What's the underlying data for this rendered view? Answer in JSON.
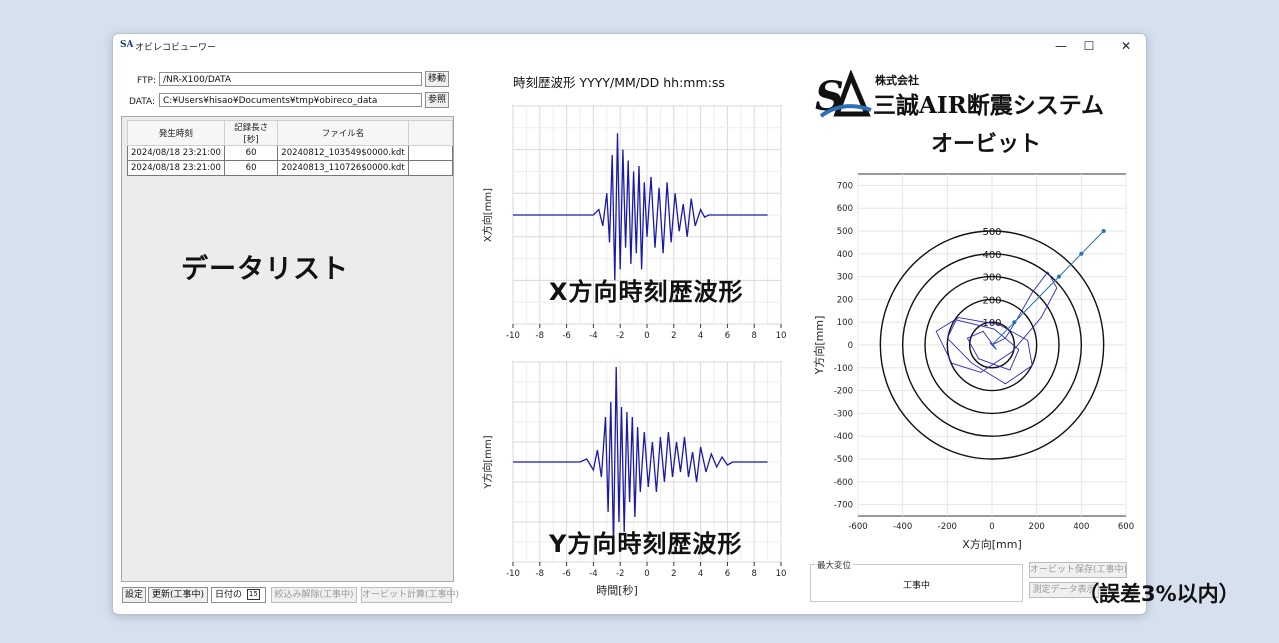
{
  "window": {
    "title": "オビレコビューワー",
    "icon": "SA"
  },
  "ftp": {
    "label": "FTP:",
    "value": "/NR-X100/DATA",
    "button": "移動"
  },
  "data_dir": {
    "label": "DATA:",
    "value": "C:¥Users¥hisao¥Documents¥tmp¥obireco_data",
    "button": "参照"
  },
  "table": {
    "headers": [
      "発生時刻",
      "記録長さ[秒]",
      "ファイル名"
    ],
    "rows": [
      [
        "2024/08/18 23:21:00",
        "60",
        "20240812_103549$0000.kdt"
      ],
      [
        "2024/08/18 23:21:00",
        "60",
        "20240813_110726$0000.kdt"
      ]
    ]
  },
  "list_label": "データリスト",
  "bottom_buttons": {
    "settings": "設定",
    "refresh": "更新(工事中)",
    "date_label": "日付の",
    "calendar": "15",
    "clear_filter": "絞込み解除(工事中)",
    "orbit_calc": "オービット計算(工事中)"
  },
  "waveform": {
    "title": "時刻歴波形 YYYY/MM/DD hh:mm:ss"
  },
  "chart_data": [
    {
      "type": "line",
      "name": "x-wave",
      "ylabel": "X方向[mm]",
      "xlabel": "",
      "overlay": "X方向時刻歴波形",
      "xlim": [
        -10,
        10
      ],
      "xticks": [
        -10,
        -8,
        -6,
        -4,
        -2,
        0,
        2,
        4,
        6,
        8,
        10
      ],
      "x": [
        -10,
        -4.0,
        -3.6,
        -3.3,
        -3.0,
        -2.8,
        -2.6,
        -2.4,
        -2.2,
        -2.0,
        -1.8,
        -1.6,
        -1.4,
        -1.2,
        -1.0,
        -0.8,
        -0.6,
        -0.4,
        -0.2,
        0.0,
        0.3,
        0.6,
        0.9,
        1.2,
        1.5,
        1.8,
        2.1,
        2.4,
        2.7,
        3.0,
        3.3,
        3.6,
        4.0,
        4.3,
        4.6,
        9.0
      ],
      "y": [
        0,
        0,
        0.05,
        -0.1,
        0.2,
        -0.25,
        0.55,
        -0.6,
        0.75,
        -0.5,
        0.6,
        -0.3,
        0.5,
        -0.45,
        0.4,
        -0.35,
        0.45,
        -0.5,
        0.3,
        -0.2,
        0.35,
        -0.3,
        0.25,
        -0.35,
        0.3,
        -0.25,
        0.2,
        -0.15,
        0.1,
        -0.2,
        0.15,
        -0.1,
        0.05,
        -0.02,
        0,
        0
      ],
      "ylim": [
        -1,
        1
      ]
    },
    {
      "type": "line",
      "name": "y-wave",
      "ylabel": "Y方向[mm]",
      "xlabel": "時間[秒]",
      "overlay": "Y方向時刻歴波形",
      "xlim": [
        -10,
        10
      ],
      "xticks": [
        -10,
        -8,
        -6,
        -4,
        -2,
        0,
        2,
        4,
        6,
        8,
        10
      ],
      "x": [
        -10,
        -5.0,
        -4.5,
        -4.0,
        -3.7,
        -3.4,
        -3.1,
        -2.9,
        -2.7,
        -2.5,
        -2.3,
        -2.1,
        -1.9,
        -1.7,
        -1.5,
        -1.3,
        -1.1,
        -0.9,
        -0.7,
        -0.5,
        -0.2,
        0.1,
        0.4,
        0.7,
        1.0,
        1.3,
        1.6,
        1.9,
        2.2,
        2.5,
        2.8,
        3.1,
        3.4,
        3.7,
        4.0,
        4.4,
        4.8,
        5.2,
        5.6,
        6.0,
        6.4,
        9.0
      ],
      "y": [
        0,
        0,
        0.03,
        -0.08,
        0.12,
        -0.15,
        0.45,
        -0.5,
        0.6,
        -0.85,
        0.95,
        -0.6,
        0.55,
        -0.7,
        0.5,
        -0.4,
        0.45,
        -0.55,
        0.35,
        -0.3,
        0.3,
        -0.25,
        0.2,
        -0.3,
        0.25,
        -0.2,
        0.3,
        -0.15,
        0.2,
        -0.1,
        0.25,
        -0.15,
        0.1,
        -0.2,
        0.15,
        -0.1,
        0.08,
        -0.05,
        0.05,
        -0.03,
        0,
        0
      ],
      "ylim": [
        -1,
        1
      ]
    },
    {
      "type": "scatter",
      "name": "orbit",
      "xlabel": "X方向[mm]",
      "ylabel": "Y方向[mm]",
      "xlim": [
        -600,
        600
      ],
      "ylim": [
        -750,
        750
      ],
      "xticks": [
        -600,
        -400,
        -200,
        0,
        200,
        400,
        600
      ],
      "yticks": [
        700,
        600,
        500,
        400,
        300,
        200,
        100,
        0,
        -100,
        -200,
        -300,
        -400,
        -500,
        -600,
        -700
      ],
      "rings": [
        100,
        200,
        300,
        400,
        500
      ],
      "trajectory": {
        "x": [
          0,
          60,
          110,
          180,
          250,
          290,
          220,
          90,
          -50,
          -180,
          -250,
          -150,
          30,
          160,
          180,
          60,
          -90,
          -200,
          -160,
          10,
          120,
          80,
          -60,
          -110,
          -40,
          20,
          -10,
          0
        ],
        "y": [
          0,
          30,
          110,
          230,
          320,
          250,
          120,
          -30,
          -120,
          -80,
          60,
          120,
          90,
          20,
          -90,
          -170,
          -80,
          30,
          110,
          70,
          -20,
          -110,
          -60,
          30,
          60,
          -20,
          10,
          0
        ]
      },
      "points": {
        "x": [
          500,
          400,
          300,
          100
        ],
        "y": [
          500,
          400,
          300,
          100
        ]
      }
    }
  ],
  "logo": {
    "company_prefix": "株式会社",
    "company": "三誠AIR断震システム",
    "subtitle": "オービット"
  },
  "max_disp": {
    "legend": "最大変位",
    "value": "工事中"
  },
  "right_buttons": {
    "save": "オービット保存(工事中)",
    "measure": "測定データ表示"
  },
  "note": "（誤差3%以内）"
}
